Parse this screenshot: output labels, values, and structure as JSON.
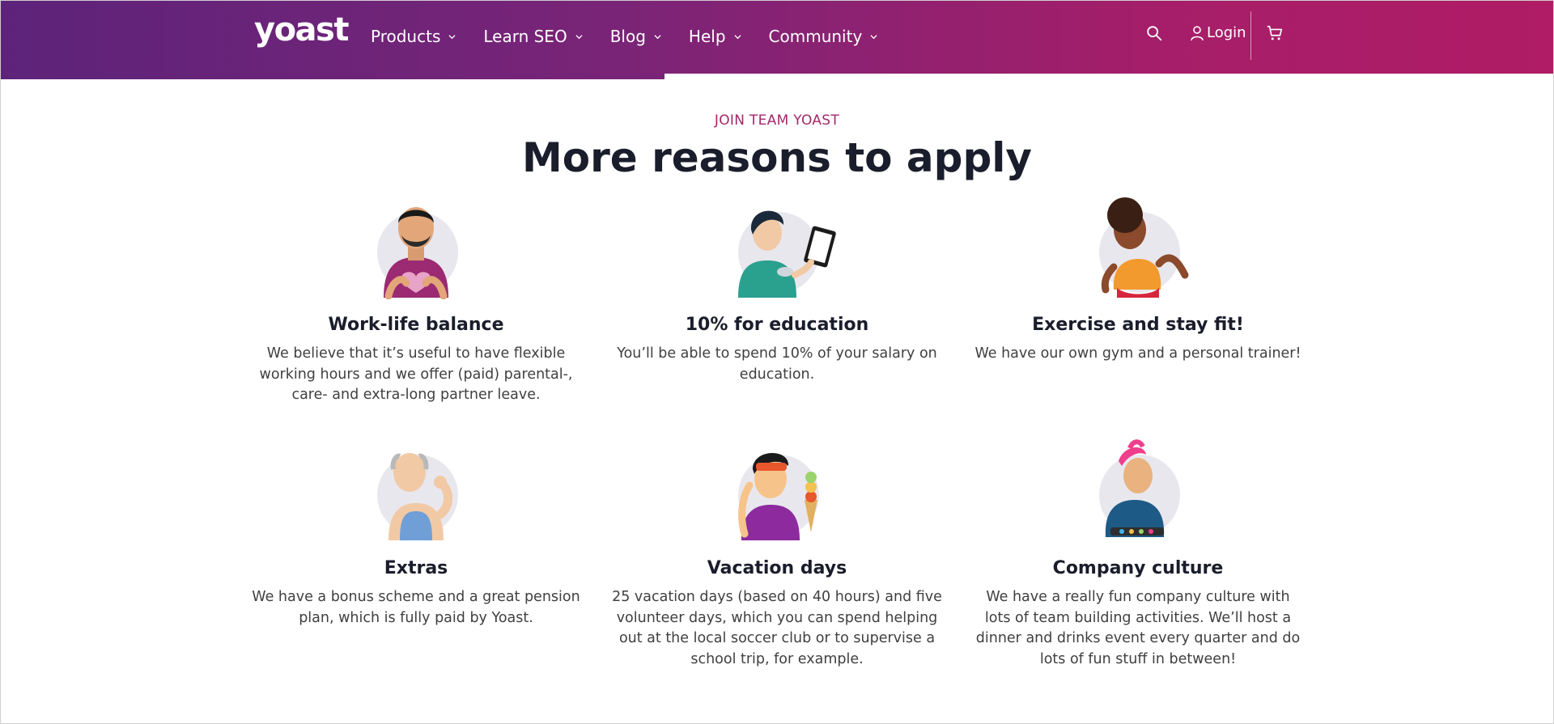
{
  "nav": {
    "logo": "yoast",
    "items": [
      {
        "label": "Products"
      },
      {
        "label": "Learn SEO"
      },
      {
        "label": "Blog"
      },
      {
        "label": "Help"
      },
      {
        "label": "Community"
      }
    ],
    "login_label": "Login",
    "search_icon": "search-icon",
    "user_icon": "user-icon",
    "cart_icon": "cart-icon",
    "brand_gradient": [
      "#5d237a",
      "#b01c66"
    ]
  },
  "section": {
    "eyebrow": "JOIN TEAM YOAST",
    "title": "More reasons to apply",
    "accent_color": "#a4286a"
  },
  "reasons": [
    {
      "title": "Work-life balance",
      "text": "We believe that it’s useful to have flexible working hours and we offer (paid) parental-, care- and extra-long partner leave.",
      "illustration": "heart-hands-man"
    },
    {
      "title": "10% for education",
      "text": "You’ll be able to spend 10% of your salary on education.",
      "illustration": "woman-with-tablet"
    },
    {
      "title": "Exercise and stay fit!",
      "text": "We have our own gym and a personal trainer!",
      "illustration": "running-woman"
    },
    {
      "title": "Extras",
      "text": "We have a bonus scheme and a great pension plan, which is fully paid by Yoast.",
      "illustration": "flexing-man"
    },
    {
      "title": "Vacation days",
      "text": "25 vacation days (based on 40 hours) and five volunteer days, which you can spend helping out at the local soccer club or to supervise a school trip, for example.",
      "illustration": "man-with-ice-cream"
    },
    {
      "title": "Company culture",
      "text": "We have a really fun company culture with lots of team building activities. We’ll host a dinner and drinks event every quarter and do lots of fun stuff in between!",
      "illustration": "dj-pink-hair"
    }
  ]
}
